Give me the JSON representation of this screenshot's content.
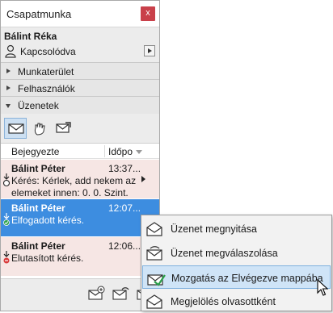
{
  "window": {
    "title": "Csapatmunka",
    "close_label": "x"
  },
  "user": {
    "name": "Bálint Réka",
    "status": "Kapcsolódva"
  },
  "sections": [
    {
      "label": "Munkaterület",
      "expanded": false
    },
    {
      "label": "Felhasználók",
      "expanded": false
    },
    {
      "label": "Üzenetek",
      "expanded": true
    }
  ],
  "toolbar": {
    "icons": [
      "inbox-icon",
      "hand-icon",
      "outbox-icon"
    ]
  },
  "list": {
    "columns": [
      "Bejegyezte",
      "Időpo"
    ],
    "rows": [
      {
        "sender": "Bálint Péter",
        "time": "13:37...",
        "body": "Kérés: Kérlek, add nekem az elemeket innen: 0. 0. Szint.",
        "state": "pending"
      },
      {
        "sender": "Bálint Péter",
        "time": "12:07...",
        "body": "Elfogadott kérés.",
        "state": "accepted"
      },
      {
        "sender": "Bálint Péter",
        "time": "12:06...",
        "body": "Elutasított kérés.",
        "state": "rejected"
      }
    ]
  },
  "context_menu": {
    "items": [
      {
        "label": "Üzenet megnyitása",
        "icon": "envelope-open-icon"
      },
      {
        "label": "Üzenet megválaszolása",
        "icon": "envelope-reply-icon"
      },
      {
        "label": "Mozgatás az Elvégezve mappába",
        "icon": "move-to-done-icon",
        "highlighted": true
      },
      {
        "label": "Megjelölés olvasottként",
        "icon": "mark-read-icon"
      }
    ]
  },
  "colors": {
    "selection": "#3d8de0",
    "close": "#c9404a",
    "accepted": "#2aa04a",
    "rejected": "#d83a3a",
    "menu_highlight": "#cfe4f7"
  }
}
